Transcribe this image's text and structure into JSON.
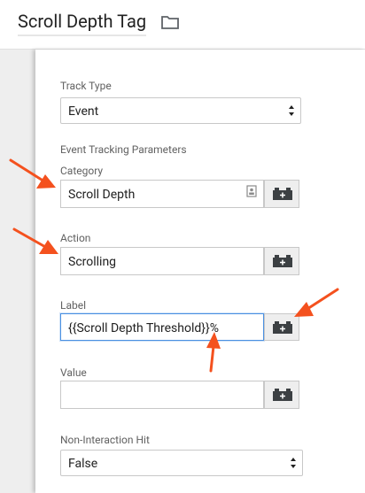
{
  "header": {
    "title": "Scroll Depth Tag",
    "folder_icon": "folder-icon"
  },
  "form": {
    "track_type": {
      "label": "Track Type",
      "value": "Event"
    },
    "section_heading": "Event Tracking Parameters",
    "category": {
      "label": "Category",
      "value": "Scroll Depth"
    },
    "action": {
      "label": "Action",
      "value": "Scrolling"
    },
    "label": {
      "label": "Label",
      "value": "{{Scroll Depth Threshold}}%"
    },
    "value": {
      "label": "Value",
      "value": ""
    },
    "non_interaction": {
      "label": "Non-Interaction Hit",
      "value": "False"
    }
  },
  "colors": {
    "annotation_arrow": "#f4511e",
    "focus_border": "#4a90e2"
  }
}
